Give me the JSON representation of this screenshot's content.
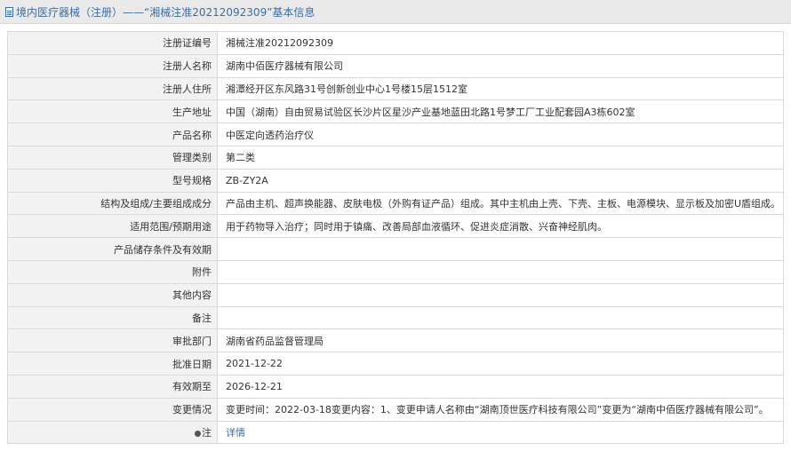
{
  "header": {
    "title": "境内医疗器械（注册）——“湘械注准20212092309”基本信息"
  },
  "rows": [
    {
      "label": "注册证编号",
      "value": "湘械注准20212092309"
    },
    {
      "label": "注册人名称",
      "value": "湖南中佰医疗器械有限公司"
    },
    {
      "label": "注册人住所",
      "value": "湘潭经开区东风路31号创新创业中心1号楼15层1512室"
    },
    {
      "label": "生产地址",
      "value": "中国（湖南）自由贸易试验区长沙片区星沙产业基地蓝田北路1号梦工厂工业配套园A3栋602室"
    },
    {
      "label": "产品名称",
      "value": "中医定向透药治疗仪"
    },
    {
      "label": "管理类别",
      "value": "第二类"
    },
    {
      "label": "型号规格",
      "value": "ZB-ZY2A"
    },
    {
      "label": "结构及组成/主要组成成分",
      "value": "产品由主机、超声换能器、皮肤电极（外购有证产品）组成。其中主机由上壳、下壳、主板、电源模块、显示板及加密U盾组成。"
    },
    {
      "label": "适用范围/预期用途",
      "value": "用于药物导入治疗；同时用于镇痛、改善局部血液循环、促进炎症消散、兴奋神经肌肉。"
    },
    {
      "label": "产品储存条件及有效期",
      "value": ""
    },
    {
      "label": "附件",
      "value": ""
    },
    {
      "label": "其他内容",
      "value": ""
    },
    {
      "label": "备注",
      "value": ""
    },
    {
      "label": "审批部门",
      "value": "湖南省药品监督管理局"
    },
    {
      "label": "批准日期",
      "value": "2021-12-22"
    },
    {
      "label": "有效期至",
      "value": "2026-12-21"
    },
    {
      "label": "变更情况",
      "value": "变更时间：2022-03-18变更内容：1、变更申请人名称由“湖南顶世医疗科技有限公司”变更为“湖南中佰医疗器械有限公司”。"
    }
  ],
  "note_row": {
    "label": "注",
    "icon": "note-icon",
    "link_text": "详情"
  }
}
